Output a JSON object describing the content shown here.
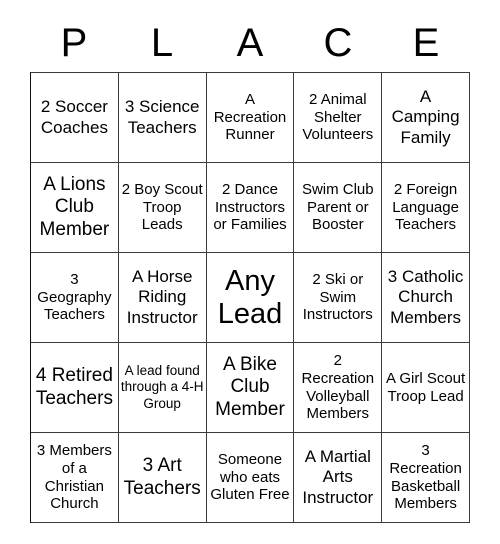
{
  "card": {
    "header_letters": [
      "P",
      "L",
      "A",
      "C",
      "E"
    ],
    "free_space_label": "Any Lead",
    "grid": [
      [
        {
          "text": "2 Soccer Coaches",
          "size": "md"
        },
        {
          "text": "3 Science Teachers",
          "size": "md"
        },
        {
          "text": "A Recreation Runner",
          "size": "sm"
        },
        {
          "text": "2 Animal Shelter Volunteers",
          "size": "sm"
        },
        {
          "text": "A Camping Family",
          "size": "md"
        }
      ],
      [
        {
          "text": "A Lions Club Member",
          "size": "lg"
        },
        {
          "text": "2 Boy Scout Troop Leads",
          "size": "sm"
        },
        {
          "text": "2 Dance Instructors or Families",
          "size": "sm"
        },
        {
          "text": "Swim Club Parent or Booster",
          "size": "sm"
        },
        {
          "text": "2 Foreign Language Teachers",
          "size": "sm"
        }
      ],
      [
        {
          "text": "3 Geography Teachers",
          "size": "sm"
        },
        {
          "text": "A Horse Riding Instructor",
          "size": "md"
        },
        {
          "text": "Any Lead",
          "size": "xl"
        },
        {
          "text": "2 Ski or Swim Instructors",
          "size": "sm"
        },
        {
          "text": "3 Catholic Church Members",
          "size": "md"
        }
      ],
      [
        {
          "text": "4 Retired Teachers",
          "size": "lg"
        },
        {
          "text": "A lead found through a 4-H Group",
          "size": "xs"
        },
        {
          "text": "A Bike Club Member",
          "size": "lg"
        },
        {
          "text": "2 Recreation Volleyball Members",
          "size": "sm"
        },
        {
          "text": "A Girl Scout Troop Lead",
          "size": "sm"
        }
      ],
      [
        {
          "text": "3 Members of a Christian Church",
          "size": "sm"
        },
        {
          "text": "3 Art Teachers",
          "size": "lg"
        },
        {
          "text": "Someone who eats Gluten Free",
          "size": "sm"
        },
        {
          "text": "A Martial Arts Instructor",
          "size": "md"
        },
        {
          "text": "3 Recreation Basketball Members",
          "size": "sm"
        }
      ]
    ]
  },
  "colors": {
    "background": "#ffffff",
    "text": "#000000",
    "grid_line": "#3a3a3a"
  }
}
